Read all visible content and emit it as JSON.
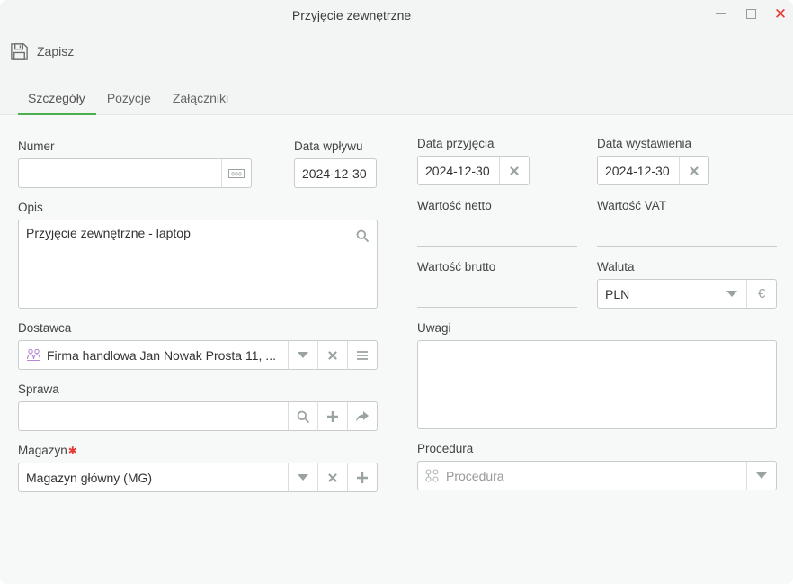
{
  "window": {
    "title": "Przyjęcie zewnętrzne",
    "close_glyph": "✕"
  },
  "toolbar": {
    "save_label": "Zapisz",
    "save_icon": "floppy-disk-icon"
  },
  "tabs": [
    {
      "label": "Szczegóły",
      "active": true
    },
    {
      "label": "Pozycje",
      "active": false
    },
    {
      "label": "Załączniki",
      "active": false
    }
  ],
  "form": {
    "numer": {
      "label": "Numer",
      "value": ""
    },
    "data_wplywu": {
      "label": "Data wpływu",
      "value": "2024-12-30"
    },
    "data_przyjecia": {
      "label": "Data przyjęcia",
      "value": "2024-12-30"
    },
    "data_wystawienia": {
      "label": "Data wystawienia",
      "value": "2024-12-30"
    },
    "opis": {
      "label": "Opis",
      "value": "Przyjęcie zewnętrzne - laptop"
    },
    "wartosc_netto": {
      "label": "Wartość netto",
      "value": ""
    },
    "wartosc_vat": {
      "label": "Wartość VAT",
      "value": ""
    },
    "wartosc_brutto": {
      "label": "Wartość brutto",
      "value": ""
    },
    "waluta": {
      "label": "Waluta",
      "value": "PLN",
      "currency_glyph": "€"
    },
    "dostawca": {
      "label": "Dostawca",
      "value": "Firma handlowa Jan Nowak Prosta 11, ..."
    },
    "uwagi": {
      "label": "Uwagi",
      "value": ""
    },
    "sprawa": {
      "label": "Sprawa",
      "value": ""
    },
    "magazyn": {
      "label": "Magazyn",
      "required_mark": "✱",
      "value": "Magazyn główny (MG)"
    },
    "procedura": {
      "label": "Procedura",
      "placeholder": "Procedura"
    }
  },
  "colors": {
    "accent": "#4caf50",
    "required": "#e53935",
    "close": "#e53935"
  }
}
